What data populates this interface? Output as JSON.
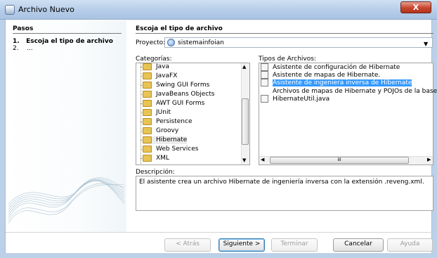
{
  "window": {
    "title": "Archivo Nuevo",
    "close_label": "X"
  },
  "steps": {
    "header": "Pasos",
    "items": [
      {
        "number": "1.",
        "label": "Escoja el tipo de archivo"
      },
      {
        "number": "2.",
        "label": "..."
      }
    ]
  },
  "main": {
    "header": "Escoja el tipo de archivo",
    "project": {
      "label": "Proyecto:",
      "value": "sistemainfoian"
    },
    "categories": {
      "label": "Categorías:",
      "items": [
        "Java",
        "JavaFX",
        "Swing GUI Forms",
        "JavaBeans Objects",
        "AWT GUI Forms",
        "JUnit",
        "Persistence",
        "Groovy",
        "Hibernate",
        "Web Services",
        "XML"
      ],
      "selected": "Hibernate"
    },
    "file_types": {
      "label": "Tipos de Archivos:",
      "items": [
        "Asistente de configuración de Hibernate",
        "Asistente de mapas de Hibernate.",
        "Asistente de ingeniera inversa de Hibernate",
        "Archivos de mapas de Hibernate y POJOs de la base de",
        "HibernateUtil.java"
      ],
      "selected": "Asistente de ingeniera inversa de Hibernate",
      "scroll_thumb_label": "III"
    },
    "description": {
      "label": "Descripción:",
      "text": "El asistente crea un archivo Hibernate de ingeniería inversa con la extensión .reveng.xml."
    }
  },
  "footer": {
    "back": "< Atrás",
    "next": "Siguiente >",
    "finish": "Terminar",
    "cancel": "Cancelar",
    "help": "Ayuda"
  },
  "colors": {
    "selection": "#3399ff",
    "titlebar": "#b6cde8",
    "close": "#c7442d"
  }
}
